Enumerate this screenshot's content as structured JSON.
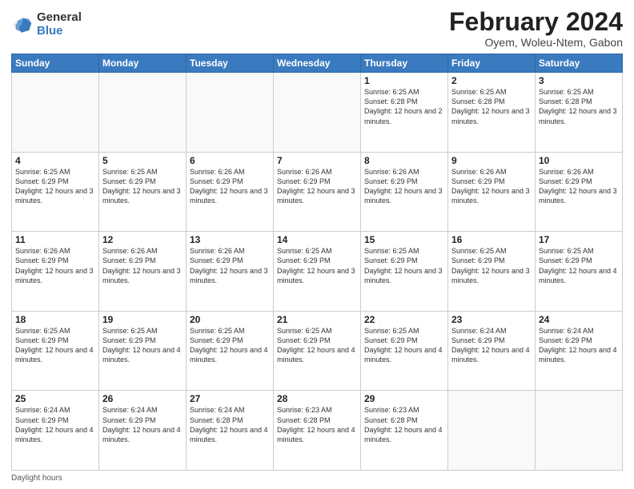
{
  "header": {
    "logo_general": "General",
    "logo_blue": "Blue",
    "title": "February 2024",
    "location": "Oyem, Woleu-Ntem, Gabon"
  },
  "days_of_week": [
    "Sunday",
    "Monday",
    "Tuesday",
    "Wednesday",
    "Thursday",
    "Friday",
    "Saturday"
  ],
  "weeks": [
    [
      {
        "day": "",
        "info": ""
      },
      {
        "day": "",
        "info": ""
      },
      {
        "day": "",
        "info": ""
      },
      {
        "day": "",
        "info": ""
      },
      {
        "day": "1",
        "info": "Sunrise: 6:25 AM\nSunset: 6:28 PM\nDaylight: 12 hours\nand 2 minutes."
      },
      {
        "day": "2",
        "info": "Sunrise: 6:25 AM\nSunset: 6:28 PM\nDaylight: 12 hours\nand 3 minutes."
      },
      {
        "day": "3",
        "info": "Sunrise: 6:25 AM\nSunset: 6:28 PM\nDaylight: 12 hours\nand 3 minutes."
      }
    ],
    [
      {
        "day": "4",
        "info": "Sunrise: 6:25 AM\nSunset: 6:29 PM\nDaylight: 12 hours\nand 3 minutes."
      },
      {
        "day": "5",
        "info": "Sunrise: 6:25 AM\nSunset: 6:29 PM\nDaylight: 12 hours\nand 3 minutes."
      },
      {
        "day": "6",
        "info": "Sunrise: 6:26 AM\nSunset: 6:29 PM\nDaylight: 12 hours\nand 3 minutes."
      },
      {
        "day": "7",
        "info": "Sunrise: 6:26 AM\nSunset: 6:29 PM\nDaylight: 12 hours\nand 3 minutes."
      },
      {
        "day": "8",
        "info": "Sunrise: 6:26 AM\nSunset: 6:29 PM\nDaylight: 12 hours\nand 3 minutes."
      },
      {
        "day": "9",
        "info": "Sunrise: 6:26 AM\nSunset: 6:29 PM\nDaylight: 12 hours\nand 3 minutes."
      },
      {
        "day": "10",
        "info": "Sunrise: 6:26 AM\nSunset: 6:29 PM\nDaylight: 12 hours\nand 3 minutes."
      }
    ],
    [
      {
        "day": "11",
        "info": "Sunrise: 6:26 AM\nSunset: 6:29 PM\nDaylight: 12 hours\nand 3 minutes."
      },
      {
        "day": "12",
        "info": "Sunrise: 6:26 AM\nSunset: 6:29 PM\nDaylight: 12 hours\nand 3 minutes."
      },
      {
        "day": "13",
        "info": "Sunrise: 6:26 AM\nSunset: 6:29 PM\nDaylight: 12 hours\nand 3 minutes."
      },
      {
        "day": "14",
        "info": "Sunrise: 6:25 AM\nSunset: 6:29 PM\nDaylight: 12 hours\nand 3 minutes."
      },
      {
        "day": "15",
        "info": "Sunrise: 6:25 AM\nSunset: 6:29 PM\nDaylight: 12 hours\nand 3 minutes."
      },
      {
        "day": "16",
        "info": "Sunrise: 6:25 AM\nSunset: 6:29 PM\nDaylight: 12 hours\nand 3 minutes."
      },
      {
        "day": "17",
        "info": "Sunrise: 6:25 AM\nSunset: 6:29 PM\nDaylight: 12 hours\nand 4 minutes."
      }
    ],
    [
      {
        "day": "18",
        "info": "Sunrise: 6:25 AM\nSunset: 6:29 PM\nDaylight: 12 hours\nand 4 minutes."
      },
      {
        "day": "19",
        "info": "Sunrise: 6:25 AM\nSunset: 6:29 PM\nDaylight: 12 hours\nand 4 minutes."
      },
      {
        "day": "20",
        "info": "Sunrise: 6:25 AM\nSunset: 6:29 PM\nDaylight: 12 hours\nand 4 minutes."
      },
      {
        "day": "21",
        "info": "Sunrise: 6:25 AM\nSunset: 6:29 PM\nDaylight: 12 hours\nand 4 minutes."
      },
      {
        "day": "22",
        "info": "Sunrise: 6:25 AM\nSunset: 6:29 PM\nDaylight: 12 hours\nand 4 minutes."
      },
      {
        "day": "23",
        "info": "Sunrise: 6:24 AM\nSunset: 6:29 PM\nDaylight: 12 hours\nand 4 minutes."
      },
      {
        "day": "24",
        "info": "Sunrise: 6:24 AM\nSunset: 6:29 PM\nDaylight: 12 hours\nand 4 minutes."
      }
    ],
    [
      {
        "day": "25",
        "info": "Sunrise: 6:24 AM\nSunset: 6:29 PM\nDaylight: 12 hours\nand 4 minutes."
      },
      {
        "day": "26",
        "info": "Sunrise: 6:24 AM\nSunset: 6:29 PM\nDaylight: 12 hours\nand 4 minutes."
      },
      {
        "day": "27",
        "info": "Sunrise: 6:24 AM\nSunset: 6:28 PM\nDaylight: 12 hours\nand 4 minutes."
      },
      {
        "day": "28",
        "info": "Sunrise: 6:23 AM\nSunset: 6:28 PM\nDaylight: 12 hours\nand 4 minutes."
      },
      {
        "day": "29",
        "info": "Sunrise: 6:23 AM\nSunset: 6:28 PM\nDaylight: 12 hours\nand 4 minutes."
      },
      {
        "day": "",
        "info": ""
      },
      {
        "day": "",
        "info": ""
      }
    ]
  ],
  "footer": {
    "note": "Daylight hours"
  }
}
